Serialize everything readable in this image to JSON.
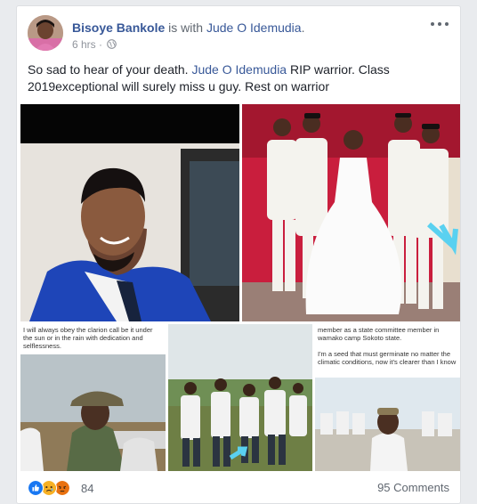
{
  "post": {
    "author": "Bisoye Bankole",
    "with_text": "is with",
    "tagged": "Jude O Idemudia",
    "tagged_suffix": ".",
    "time": "6 hrs",
    "privacy_icon": "globe-icon",
    "body_part1": "So sad to hear of your death. ",
    "body_mention": "Jude O Idemudia",
    "body_part2": " RIP warrior. Class 2019exceptional will surely miss u guy. Rest on warrior"
  },
  "photos": {
    "caption_bl": "I will always obey the clarion call be it under the sun or in the rain with dedication and selflessness.",
    "caption_br": "member as a state committee member in wamako camp Sokoto state.\n\nI'm a seed that must germinate no matter the climatic conditions, now it's clearer than I know"
  },
  "footer": {
    "reaction_count": "84",
    "comments": "95 Comments",
    "reaction_icons": [
      "like-icon",
      "sad-icon",
      "angry-icon"
    ],
    "colors": {
      "like": "#1877f2",
      "sad": "#f7b125",
      "angry": "#e9710f"
    }
  }
}
